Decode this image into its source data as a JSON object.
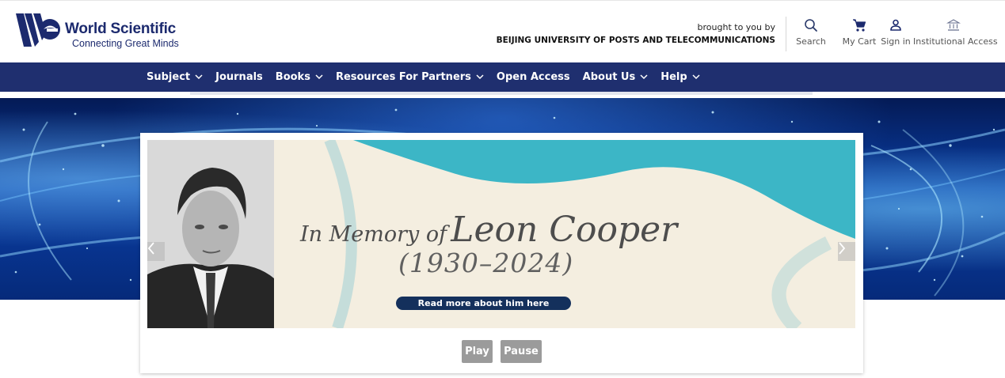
{
  "header": {
    "logo_title": "World Scientific",
    "logo_tagline": "Connecting Great Minds",
    "brought_label": "brought to you by",
    "institution": "BEIJING UNIVERSITY OF POSTS AND TELECOMMUNICATIONS",
    "actions": [
      {
        "label": "Search",
        "icon": "search-icon"
      },
      {
        "label": "My Cart",
        "icon": "cart-icon"
      },
      {
        "label": "Sign in",
        "icon": "user-icon"
      },
      {
        "label": "Institutional Access",
        "icon": "institution-icon"
      }
    ]
  },
  "nav": {
    "items": [
      {
        "label": "Subject",
        "dropdown": true
      },
      {
        "label": "Journals",
        "dropdown": false
      },
      {
        "label": "Books",
        "dropdown": true
      },
      {
        "label": "Resources For Partners",
        "dropdown": true
      },
      {
        "label": "Open Access",
        "dropdown": false
      },
      {
        "label": "About Us",
        "dropdown": true
      },
      {
        "label": "Help",
        "dropdown": true
      }
    ]
  },
  "carousel": {
    "slide": {
      "line1_small": "In Memory of",
      "line1_big": "Leon Cooper",
      "line2": "(1930–2024)",
      "cta": "Read more about him here"
    },
    "play_label": "Play",
    "pause_label": "Pause"
  },
  "colors": {
    "brand_navy": "#1f2f6f",
    "logo_blue": "#1c2a6e",
    "slide_teal": "#3cb6c6",
    "button_gray": "#9b9b9b"
  }
}
